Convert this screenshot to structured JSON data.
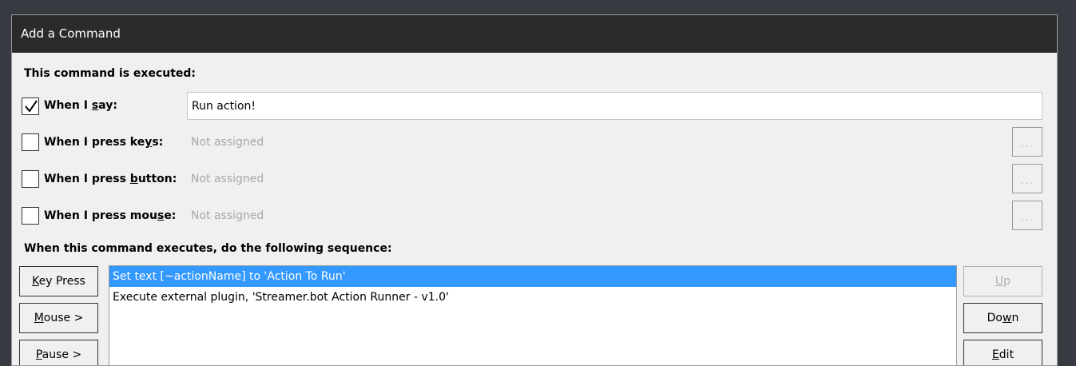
{
  "dialog": {
    "title": "Add a Command",
    "executed_header": "This command is executed:",
    "sequence_header": "When this command executes, do the following sequence:"
  },
  "triggers": {
    "say": {
      "checked": true,
      "label_pre": "When I ",
      "label_ul": "s",
      "label_post": "ay:",
      "value": "Run action!"
    },
    "keys": {
      "checked": false,
      "label_pre": "When I press ke",
      "label_ul": "y",
      "label_post": "s:",
      "status": "Not assigned",
      "browse": "..."
    },
    "button": {
      "checked": false,
      "label_pre": "When I press ",
      "label_ul": "b",
      "label_post": "utton:",
      "status": "Not assigned",
      "browse": "..."
    },
    "mouse": {
      "checked": false,
      "label_pre": "When I press mou",
      "label_ul": "s",
      "label_post": "e:",
      "status": "Not assigned",
      "browse": "..."
    }
  },
  "action_buttons": {
    "key_press": {
      "ul": "K",
      "rest": "ey Press"
    },
    "mouse": {
      "ul": "M",
      "rest": "ouse >"
    },
    "pause": {
      "ul": "P",
      "rest": "ause >"
    }
  },
  "sequence": [
    {
      "text": "Set text [~actionName] to 'Action To Run'",
      "selected": true
    },
    {
      "text": "Execute external plugin, 'Streamer.bot Action Runner - v1.0'",
      "selected": false
    }
  ],
  "order_buttons": {
    "up": {
      "ul": "U",
      "rest": "p",
      "disabled": true
    },
    "down": {
      "pre": "Do",
      "ul": "w",
      "rest": "n",
      "disabled": false
    },
    "edit": {
      "ul": "E",
      "rest": "dit",
      "disabled": false
    }
  }
}
